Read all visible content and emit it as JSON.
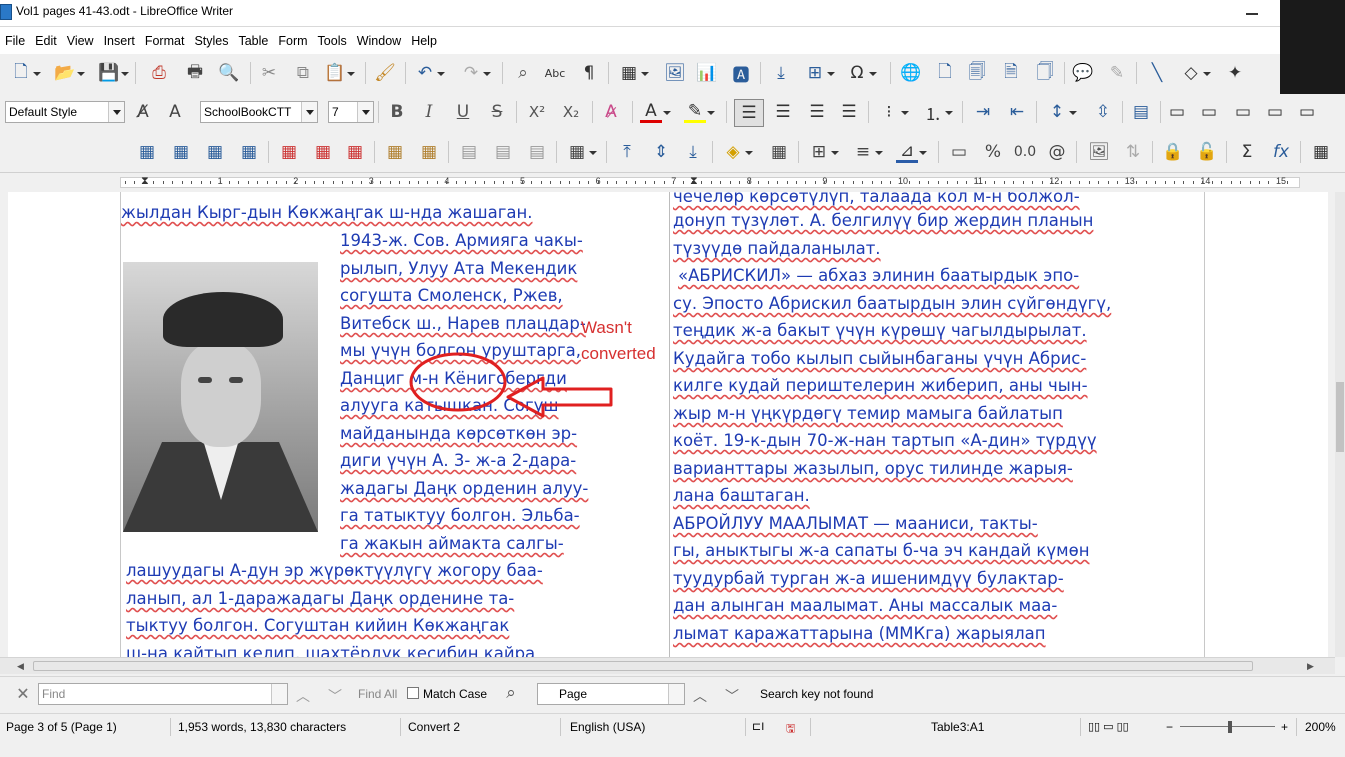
{
  "window": {
    "title": "Vol1 pages 41-43.odt - LibreOffice Writer"
  },
  "menu": [
    "File",
    "Edit",
    "View",
    "Insert",
    "Format",
    "Styles",
    "Table",
    "Form",
    "Tools",
    "Window",
    "Help"
  ],
  "formatting": {
    "paragraph_style": "Default Style",
    "font_name": "SchoolBookCTT",
    "font_size": "7"
  },
  "ruler": {
    "numbers": [
      "1",
      "2",
      "3",
      "4",
      "5",
      "6",
      "7",
      "8",
      "9",
      "10",
      "11",
      "12",
      "13",
      "14",
      "15"
    ]
  },
  "document": {
    "left_column": [
      "жылдан Кырг-дын  Көкжаңгак ш-нда жашаган.",
      "1943-ж. Сов. Армияга чакы-",
      "рылып, Улуу Ата Мекендик",
      "согушта  Смоленск,  Ржев,",
      "Витебск ш., Нарев плацдар-",
      "мы үчүн болгон уруштарга,",
      "Данциг  м-н  Кёнигсбергди",
      "алууга   катышкан.  Согуш",
      "майданында  көрсөткөн  эр-",
      "диги үчүн  А.  3- ж-а 2-дара-",
      "жадагы Даңк орденин алуу-",
      "га татыктуу болгон. Эльба-",
      "га    жакын  аймакта  салгы-",
      "лашуудагы А-дун эр жүрөктүүлүгү   жогору баа-",
      "ланып,    ал    1-даражадагы    Даңк  орденине та-",
      "тыктуу  болгон.  Согуштан    кийин  Көкжаңгак",
      "ш-на кайтып келип, шахтёрдук кесибин кайра"
    ],
    "right_column": [
      "чечелөр  көрсөтүлүп,  талаада  кол м-н болжол-",
      "донуп түзүлөт. А. белгилүү бир жердин  планын",
      "түзүүдө  пайдаланылат.",
      "«АБРИСКИЛ» — абхаз элинин баатырдык эпо-",
      "су. Эпосто Абрискил баатырдын элин сүйгөндүгү,",
      "теңдик ж-а бакыт үчүн күрөшү чагылдырылат.",
      "Кудайга тобо кылып сыйынбаганы үчүн Абрис-",
      "килге кудай периштелерин жиберип, аны чын-",
      "жыр м-н үңкүрдөгү темир мамыга байлатып",
      "коёт. 19-к-дын 70-ж-нан тартып «А-дин» түрдүү",
      "варианттары жазылып,  орус тилинде жарыя-",
      "лана  баштаган.",
      "АБРОЙЛУУ МААЛЫМАТ — мааниси,  такты-",
      "гы, аныктыгы ж-а сапаты б-ча эч кандай күмөн",
      "туудурбай   турган   ж-а   ишенимдүү   булактар-",
      "дан алынган маалымат. Аны массалык маа-",
      "лымат    каражаттарына    (ММКга)    жарыялап"
    ],
    "annotation": [
      "Wasn't",
      "converted"
    ]
  },
  "findbar": {
    "find_placeholder": "Find",
    "find_all": "Find All",
    "match_case": "Match Case",
    "search_scope": "Page",
    "status": "Search key not found"
  },
  "statusbar": {
    "page": "Page 3 of 5 (Page 1)",
    "words": "1,953 words, 13,830 characters",
    "page_style": "Convert 2",
    "language": "English (USA)",
    "cell": "Table3:A1",
    "zoom": "200%"
  }
}
